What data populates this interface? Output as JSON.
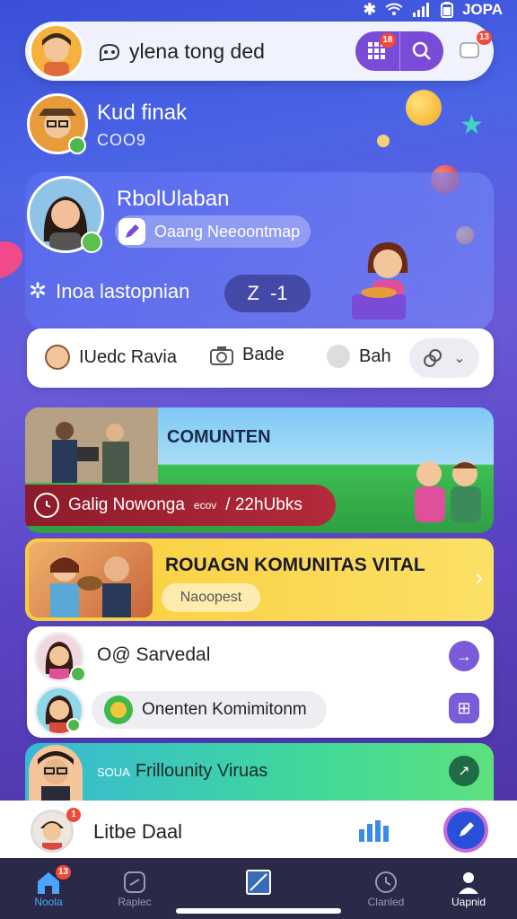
{
  "status_bar": {
    "time": "JOPA"
  },
  "header": {
    "app_name": "ylena tong ded",
    "grid_badge": "18",
    "messages_badge": "13"
  },
  "profile": {
    "name": "Kud finak",
    "code": "COO9"
  },
  "hero": {
    "name": "RbolUlaban",
    "chip_label": "Oaang Neeoontmap",
    "section_label": "Inoa lastopnian",
    "score_left": "Z",
    "score_right": "-1"
  },
  "quick_row": {
    "item1": "IUedc Ravia",
    "item2": "Bade",
    "item3": "Bah"
  },
  "community_banner": {
    "title": "COMUNTEN",
    "bar_text": "Galig Nowonga",
    "bar_suffix": "ecov",
    "bar_count": "/ 22hUbks"
  },
  "yellow_card": {
    "title": "ROUAGN KOMUNITAS VITAL",
    "chip": "Naoopest"
  },
  "list_card": {
    "name": "O@ Sarvedal",
    "chip": "Onenten Komimitonm"
  },
  "green_card": {
    "title": "Frillounity Viruas",
    "prefix": "SOUA"
  },
  "user_bar": {
    "name": "Litbe Daal",
    "badge": "1"
  },
  "nav": {
    "items": [
      {
        "label": "Noola",
        "badge": "13"
      },
      {
        "label": "Raplec"
      },
      {
        "label": ""
      },
      {
        "label": "Clanled"
      },
      {
        "label": "Uapnid"
      }
    ]
  },
  "colors": {
    "accent_purple": "#7a4bd6",
    "badge_red": "#f04a3a",
    "yellow_card": "#f9cd3a",
    "nav_bg": "#2a2a48"
  }
}
